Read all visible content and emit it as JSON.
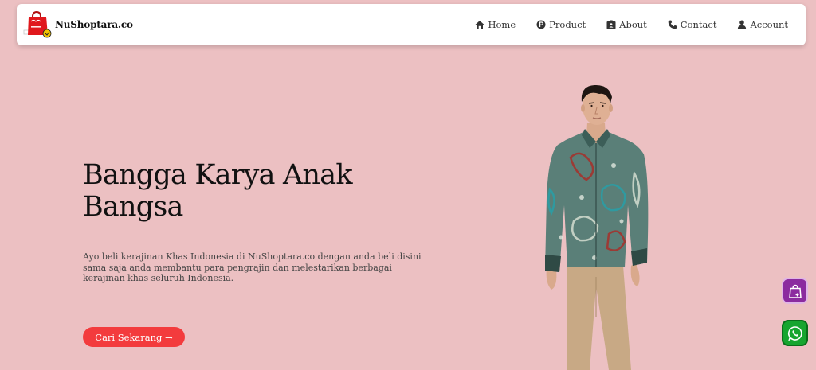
{
  "brand": {
    "name": "NuShoptara.co",
    "logo_icon": "shopping-bag-icon"
  },
  "nav": {
    "items": [
      {
        "label": "Home",
        "icon": "home-icon"
      },
      {
        "label": "Product",
        "icon": "product-icon"
      },
      {
        "label": "About",
        "icon": "about-icon"
      },
      {
        "label": "Contact",
        "icon": "phone-icon"
      },
      {
        "label": "Account",
        "icon": "user-icon"
      }
    ]
  },
  "hero": {
    "title": "Bangga Karya Anak Bangsa",
    "description": "Ayo beli kerajinan Khas Indonesia di NuShoptara.co dengan anda beli disini sama saja anda membantu para pengrajin dan melestarikan berbagai kerajinan khas seluruh Indonesia.",
    "cta_label": "Cari Sekarang →",
    "image": "batik-shirt-model"
  },
  "floating": {
    "cart_icon": "shopping-bag-icon",
    "whatsapp_icon": "whatsapp-icon"
  },
  "colors": {
    "background": "#ecc0c2",
    "cta": "#f33b3d",
    "cart_button": "#8b2b9f",
    "whatsapp_button": "#17a52f"
  }
}
